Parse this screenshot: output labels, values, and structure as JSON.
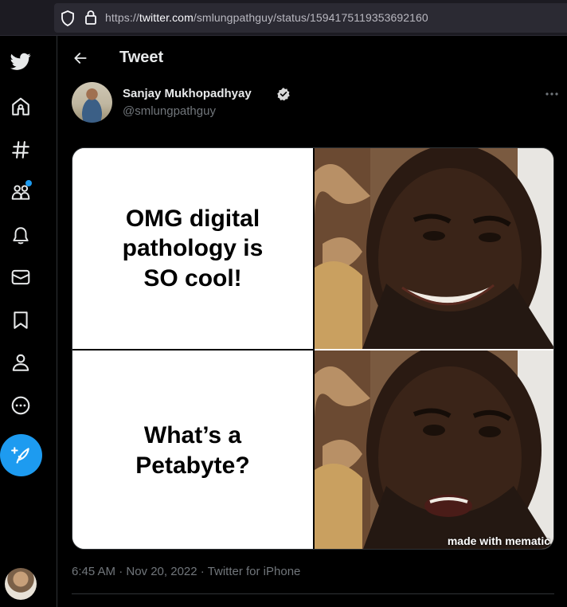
{
  "browser": {
    "url_prefix": "https://",
    "url_domain": "twitter.com",
    "url_path": "/smlungpathguy/status/1594175119353692160"
  },
  "sidebar": {
    "items": [
      {
        "name": "twitter-logo",
        "icon": "bird-icon"
      },
      {
        "name": "home",
        "icon": "home-icon"
      },
      {
        "name": "explore",
        "icon": "hashtag-icon"
      },
      {
        "name": "communities",
        "icon": "people-icon",
        "notification": true
      },
      {
        "name": "notifications",
        "icon": "bell-icon"
      },
      {
        "name": "messages",
        "icon": "mail-icon"
      },
      {
        "name": "bookmarks",
        "icon": "bookmark-icon"
      },
      {
        "name": "profile",
        "icon": "person-icon"
      },
      {
        "name": "more",
        "icon": "more-circle-icon"
      },
      {
        "name": "compose",
        "icon": "feather-plus-icon"
      }
    ],
    "accent_color": "#1d9bf0"
  },
  "header": {
    "title": "Tweet"
  },
  "tweet": {
    "author_name": "Sanjay Mukhopadhyay",
    "author_handle": "@smlungpathguy",
    "verified": true,
    "meme": {
      "top_text": "OMG digital pathology is SO cool!",
      "bottom_text": "What’s a Petabyte?",
      "watermark": "made with mematic"
    },
    "timestamp": "6:45 AM · Nov 20, 2022 · Twitter for iPhone"
  }
}
